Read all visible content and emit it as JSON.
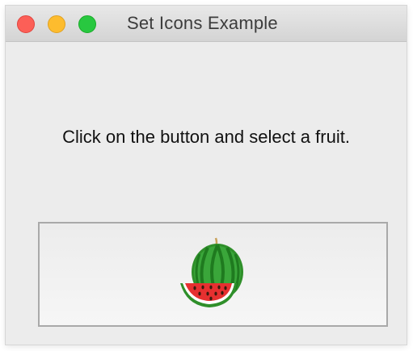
{
  "window": {
    "title": "Set Icons Example",
    "controls": [
      "close",
      "minimize",
      "zoom"
    ]
  },
  "main": {
    "prompt": "Click on the button and select a fruit.",
    "button": {
      "icon": "watermelon-icon",
      "label": ""
    }
  },
  "colors": {
    "close": "#fc5f57",
    "minimize": "#fdbc2e",
    "zoom": "#28c840",
    "window_bg": "#ececec"
  }
}
